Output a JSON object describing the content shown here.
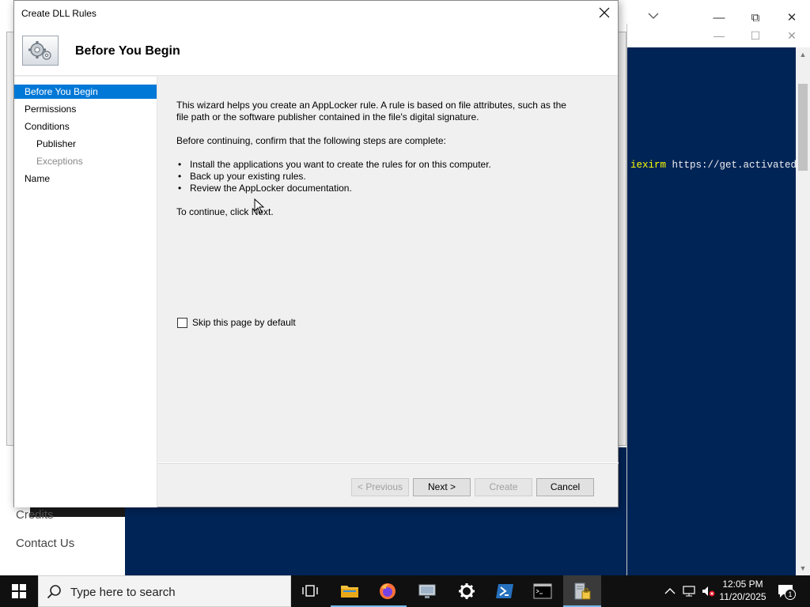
{
  "powershell": {
    "command": "iexirm",
    "arg": " https://get.activated."
  },
  "website": {
    "credits": "Credits",
    "contact": "Contact Us"
  },
  "dialog": {
    "title": "Create DLL Rules",
    "header_title": "Before You Begin",
    "nav": [
      {
        "label": "Before You Begin",
        "state": "active"
      },
      {
        "label": "Permissions",
        "state": "normal"
      },
      {
        "label": "Conditions",
        "state": "normal"
      },
      {
        "label": "Publisher",
        "state": "normal"
      },
      {
        "label": "Exceptions",
        "state": "disabled"
      },
      {
        "label": "Name",
        "state": "normal"
      }
    ],
    "intro_line1": "This wizard helps you create an AppLocker rule. A rule is based on file attributes, such as the",
    "intro_line2": "file path or the software publisher contained in the file's digital signature.",
    "before_text": "Before continuing, confirm that the following steps are complete:",
    "steps": [
      "Install the applications you want to create the rules for on this computer.",
      "Back up your existing rules.",
      "Review the AppLocker documentation."
    ],
    "continue_text": "To continue, click Next.",
    "skip_label": "Skip this page by default",
    "skip_checked": false,
    "buttons": {
      "previous": "< Previous",
      "next": "Next >",
      "create": "Create",
      "cancel": "Cancel"
    }
  },
  "taskbar": {
    "search_placeholder": "Type here to search",
    "apps": [
      "task-view",
      "file-explorer",
      "firefox",
      "remote-desktop",
      "settings",
      "powershell",
      "command-prompt",
      "server-manager"
    ],
    "time": "12:05 PM",
    "date": "11/20/2025",
    "notification_count": "1",
    "accent": "#0078d7"
  }
}
